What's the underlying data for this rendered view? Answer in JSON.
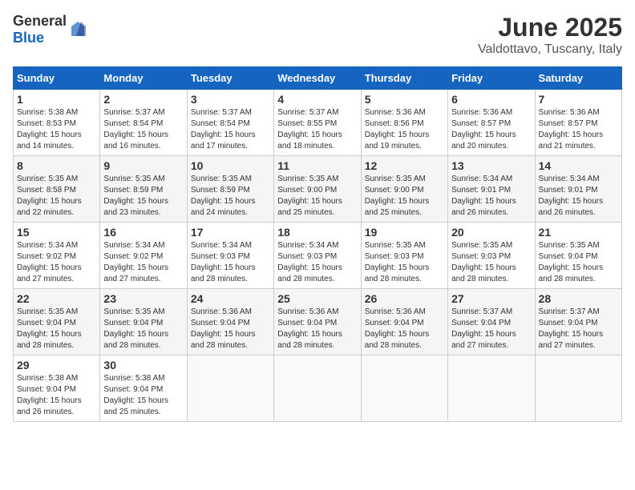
{
  "logo": {
    "general": "General",
    "blue": "Blue"
  },
  "title": "June 2025",
  "subtitle": "Valdottavo, Tuscany, Italy",
  "weekdays": [
    "Sunday",
    "Monday",
    "Tuesday",
    "Wednesday",
    "Thursday",
    "Friday",
    "Saturday"
  ],
  "weeks": [
    [
      {
        "day": "1",
        "sunrise": "5:38 AM",
        "sunset": "8:53 PM",
        "daylight": "15 hours and 14 minutes."
      },
      {
        "day": "2",
        "sunrise": "5:37 AM",
        "sunset": "8:54 PM",
        "daylight": "15 hours and 16 minutes."
      },
      {
        "day": "3",
        "sunrise": "5:37 AM",
        "sunset": "8:54 PM",
        "daylight": "15 hours and 17 minutes."
      },
      {
        "day": "4",
        "sunrise": "5:37 AM",
        "sunset": "8:55 PM",
        "daylight": "15 hours and 18 minutes."
      },
      {
        "day": "5",
        "sunrise": "5:36 AM",
        "sunset": "8:56 PM",
        "daylight": "15 hours and 19 minutes."
      },
      {
        "day": "6",
        "sunrise": "5:36 AM",
        "sunset": "8:57 PM",
        "daylight": "15 hours and 20 minutes."
      },
      {
        "day": "7",
        "sunrise": "5:36 AM",
        "sunset": "8:57 PM",
        "daylight": "15 hours and 21 minutes."
      }
    ],
    [
      {
        "day": "8",
        "sunrise": "5:35 AM",
        "sunset": "8:58 PM",
        "daylight": "15 hours and 22 minutes."
      },
      {
        "day": "9",
        "sunrise": "5:35 AM",
        "sunset": "8:59 PM",
        "daylight": "15 hours and 23 minutes."
      },
      {
        "day": "10",
        "sunrise": "5:35 AM",
        "sunset": "8:59 PM",
        "daylight": "15 hours and 24 minutes."
      },
      {
        "day": "11",
        "sunrise": "5:35 AM",
        "sunset": "9:00 PM",
        "daylight": "15 hours and 25 minutes."
      },
      {
        "day": "12",
        "sunrise": "5:35 AM",
        "sunset": "9:00 PM",
        "daylight": "15 hours and 25 minutes."
      },
      {
        "day": "13",
        "sunrise": "5:34 AM",
        "sunset": "9:01 PM",
        "daylight": "15 hours and 26 minutes."
      },
      {
        "day": "14",
        "sunrise": "5:34 AM",
        "sunset": "9:01 PM",
        "daylight": "15 hours and 26 minutes."
      }
    ],
    [
      {
        "day": "15",
        "sunrise": "5:34 AM",
        "sunset": "9:02 PM",
        "daylight": "15 hours and 27 minutes."
      },
      {
        "day": "16",
        "sunrise": "5:34 AM",
        "sunset": "9:02 PM",
        "daylight": "15 hours and 27 minutes."
      },
      {
        "day": "17",
        "sunrise": "5:34 AM",
        "sunset": "9:03 PM",
        "daylight": "15 hours and 28 minutes."
      },
      {
        "day": "18",
        "sunrise": "5:34 AM",
        "sunset": "9:03 PM",
        "daylight": "15 hours and 28 minutes."
      },
      {
        "day": "19",
        "sunrise": "5:35 AM",
        "sunset": "9:03 PM",
        "daylight": "15 hours and 28 minutes."
      },
      {
        "day": "20",
        "sunrise": "5:35 AM",
        "sunset": "9:03 PM",
        "daylight": "15 hours and 28 minutes."
      },
      {
        "day": "21",
        "sunrise": "5:35 AM",
        "sunset": "9:04 PM",
        "daylight": "15 hours and 28 minutes."
      }
    ],
    [
      {
        "day": "22",
        "sunrise": "5:35 AM",
        "sunset": "9:04 PM",
        "daylight": "15 hours and 28 minutes."
      },
      {
        "day": "23",
        "sunrise": "5:35 AM",
        "sunset": "9:04 PM",
        "daylight": "15 hours and 28 minutes."
      },
      {
        "day": "24",
        "sunrise": "5:36 AM",
        "sunset": "9:04 PM",
        "daylight": "15 hours and 28 minutes."
      },
      {
        "day": "25",
        "sunrise": "5:36 AM",
        "sunset": "9:04 PM",
        "daylight": "15 hours and 28 minutes."
      },
      {
        "day": "26",
        "sunrise": "5:36 AM",
        "sunset": "9:04 PM",
        "daylight": "15 hours and 28 minutes."
      },
      {
        "day": "27",
        "sunrise": "5:37 AM",
        "sunset": "9:04 PM",
        "daylight": "15 hours and 27 minutes."
      },
      {
        "day": "28",
        "sunrise": "5:37 AM",
        "sunset": "9:04 PM",
        "daylight": "15 hours and 27 minutes."
      }
    ],
    [
      {
        "day": "29",
        "sunrise": "5:38 AM",
        "sunset": "9:04 PM",
        "daylight": "15 hours and 26 minutes."
      },
      {
        "day": "30",
        "sunrise": "5:38 AM",
        "sunset": "9:04 PM",
        "daylight": "15 hours and 25 minutes."
      },
      null,
      null,
      null,
      null,
      null
    ]
  ],
  "labels": {
    "sunrise": "Sunrise:",
    "sunset": "Sunset:",
    "daylight": "Daylight:"
  }
}
